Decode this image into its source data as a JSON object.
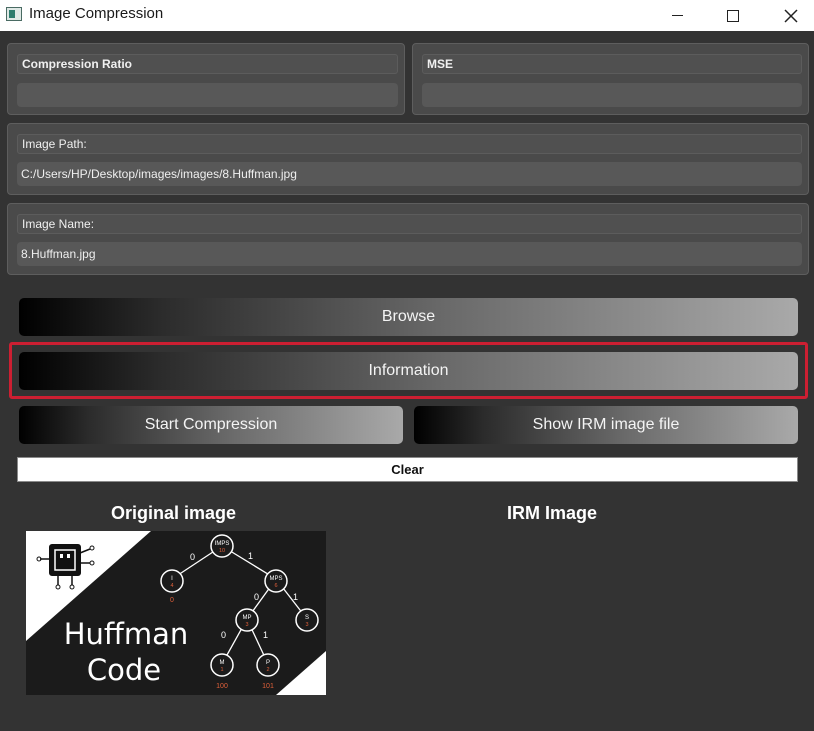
{
  "window": {
    "title": "Image Compression",
    "icons": {
      "app": "app-icon",
      "minimize": "minimize-icon",
      "maximize": "maximize-icon",
      "close": "close-icon"
    }
  },
  "compression_ratio": {
    "label": "Compression Ratio",
    "value": ""
  },
  "mse": {
    "label": "MSE",
    "value": ""
  },
  "image_path": {
    "label": "Image Path:",
    "value": "C:/Users/HP/Desktop/images/images/8.Huffman.jpg"
  },
  "image_name": {
    "label": "Image Name:",
    "value": "8.Huffman.jpg"
  },
  "buttons": {
    "browse": "Browse",
    "information": "Information",
    "start_compression": "Start Compression",
    "show_irm": "Show IRM  image file",
    "clear": "Clear"
  },
  "sections": {
    "original": "Original image",
    "irm": "IRM Image"
  },
  "preview_image": {
    "title_line1": "Huffman",
    "title_line2": "Code",
    "tree": {
      "root": {
        "label": "IMPS",
        "value": "10"
      },
      "left": {
        "label": "I",
        "value": "4",
        "code": "0"
      },
      "right": {
        "label": "MPS",
        "value": "6"
      },
      "mp": {
        "label": "MP",
        "value": "3"
      },
      "s": {
        "label": "S",
        "value": "3"
      },
      "m": {
        "label": "M",
        "value": "1",
        "code": "100"
      },
      "p": {
        "label": "P",
        "value": "2",
        "code": "101"
      },
      "edges": [
        "0",
        "1",
        "0",
        "1",
        "0",
        "1"
      ]
    },
    "colors": {
      "background": "#1b1b1b",
      "stripe": "#ffffff",
      "code": "#e0603a"
    }
  }
}
